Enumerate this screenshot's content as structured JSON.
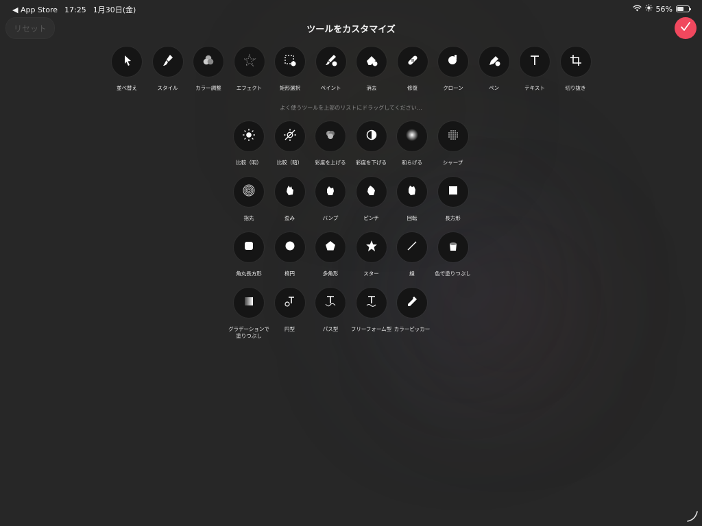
{
  "status_bar": {
    "back_app": "◀ App Store",
    "time": "17:25",
    "date": "1月30日(金)",
    "battery_text": "56%",
    "battery_level": 0.56
  },
  "header": {
    "reset_label": "リセット",
    "title": "ツールをカスタマイズ",
    "confirm_icon": "checkmark-icon"
  },
  "favorites": [
    {
      "label": "並べ替え",
      "icon": "arrow-cursor"
    },
    {
      "label": "スタイル",
      "icon": "brush"
    },
    {
      "label": "カラー調整",
      "icon": "color-circles"
    },
    {
      "label": "エフェクト",
      "icon": "star-sparkle"
    },
    {
      "label": "矩形選択",
      "icon": "marquee"
    },
    {
      "label": "ペイント",
      "icon": "paint-brush"
    },
    {
      "label": "消去",
      "icon": "eraser"
    },
    {
      "label": "修復",
      "icon": "bandage"
    },
    {
      "label": "クローン",
      "icon": "stamp"
    },
    {
      "label": "ペン",
      "icon": "pen"
    },
    {
      "label": "テキスト",
      "icon": "text-t"
    },
    {
      "label": "切り抜き",
      "icon": "crop"
    }
  ],
  "hint": "よく使うツールを上部のリストにドラッグしてください…",
  "available": [
    {
      "label": "比較（明）",
      "icon": "sun"
    },
    {
      "label": "比較（暗）",
      "icon": "sun-slash"
    },
    {
      "label": "彩度を上げる",
      "icon": "saturate"
    },
    {
      "label": "彩度を下げる",
      "icon": "half-circle"
    },
    {
      "label": "和らげる",
      "icon": "soft-glow"
    },
    {
      "label": "シャープ",
      "icon": "dots-circle"
    },
    {
      "label": "指先",
      "icon": "fingerprint"
    },
    {
      "label": "歪み",
      "icon": "hand-warp"
    },
    {
      "label": "バンプ",
      "icon": "hand-bump"
    },
    {
      "label": "ピンチ",
      "icon": "hand-pinch"
    },
    {
      "label": "回転",
      "icon": "hand-rotate"
    },
    {
      "label": "長方形",
      "icon": "square"
    },
    {
      "label": "角丸長方形",
      "icon": "rounded-square"
    },
    {
      "label": "楕円",
      "icon": "ellipse"
    },
    {
      "label": "多角形",
      "icon": "pentagon"
    },
    {
      "label": "スター",
      "icon": "star"
    },
    {
      "label": "線",
      "icon": "line"
    },
    {
      "label": "色で塗りつぶし",
      "icon": "bucket"
    },
    {
      "label": "グラデーションで塗りつぶし",
      "icon": "gradient-square"
    },
    {
      "label": "円型",
      "icon": "text-circle"
    },
    {
      "label": "パス型",
      "icon": "text-path"
    },
    {
      "label": "フリーフォーム型",
      "icon": "text-freeform"
    },
    {
      "label": "カラーピッカー",
      "icon": "eyedropper"
    }
  ]
}
